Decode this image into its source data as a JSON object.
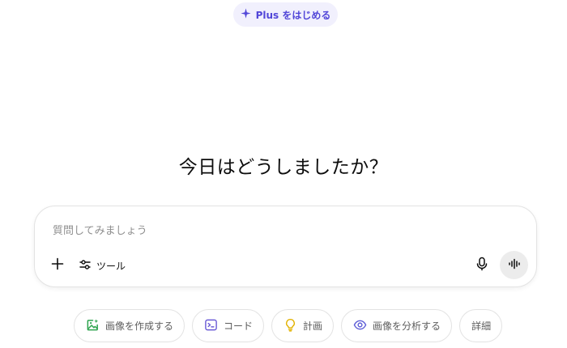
{
  "upgrade": {
    "label": "Plus をはじめる",
    "icon": "sparkle-icon",
    "color": "#5146d8"
  },
  "heading": "今日はどうしましたか？",
  "composer": {
    "placeholder": "質問してみましょう",
    "value": "",
    "add_icon": "plus-icon",
    "tools_label": "ツール",
    "tools_icon": "sliders-icon",
    "mic_icon": "microphone-icon",
    "voice_icon": "voice-waveform-icon"
  },
  "suggestions": [
    {
      "label": "画像を作成する",
      "icon": "image-create-icon",
      "color": "#2ea44f"
    },
    {
      "label": "コード",
      "icon": "terminal-icon",
      "color": "#6b5bd6"
    },
    {
      "label": "計画",
      "icon": "lightbulb-icon",
      "color": "#e2b200"
    },
    {
      "label": "画像を分析する",
      "icon": "eye-icon",
      "color": "#5b5bd6"
    },
    {
      "label": "詳細"
    }
  ]
}
